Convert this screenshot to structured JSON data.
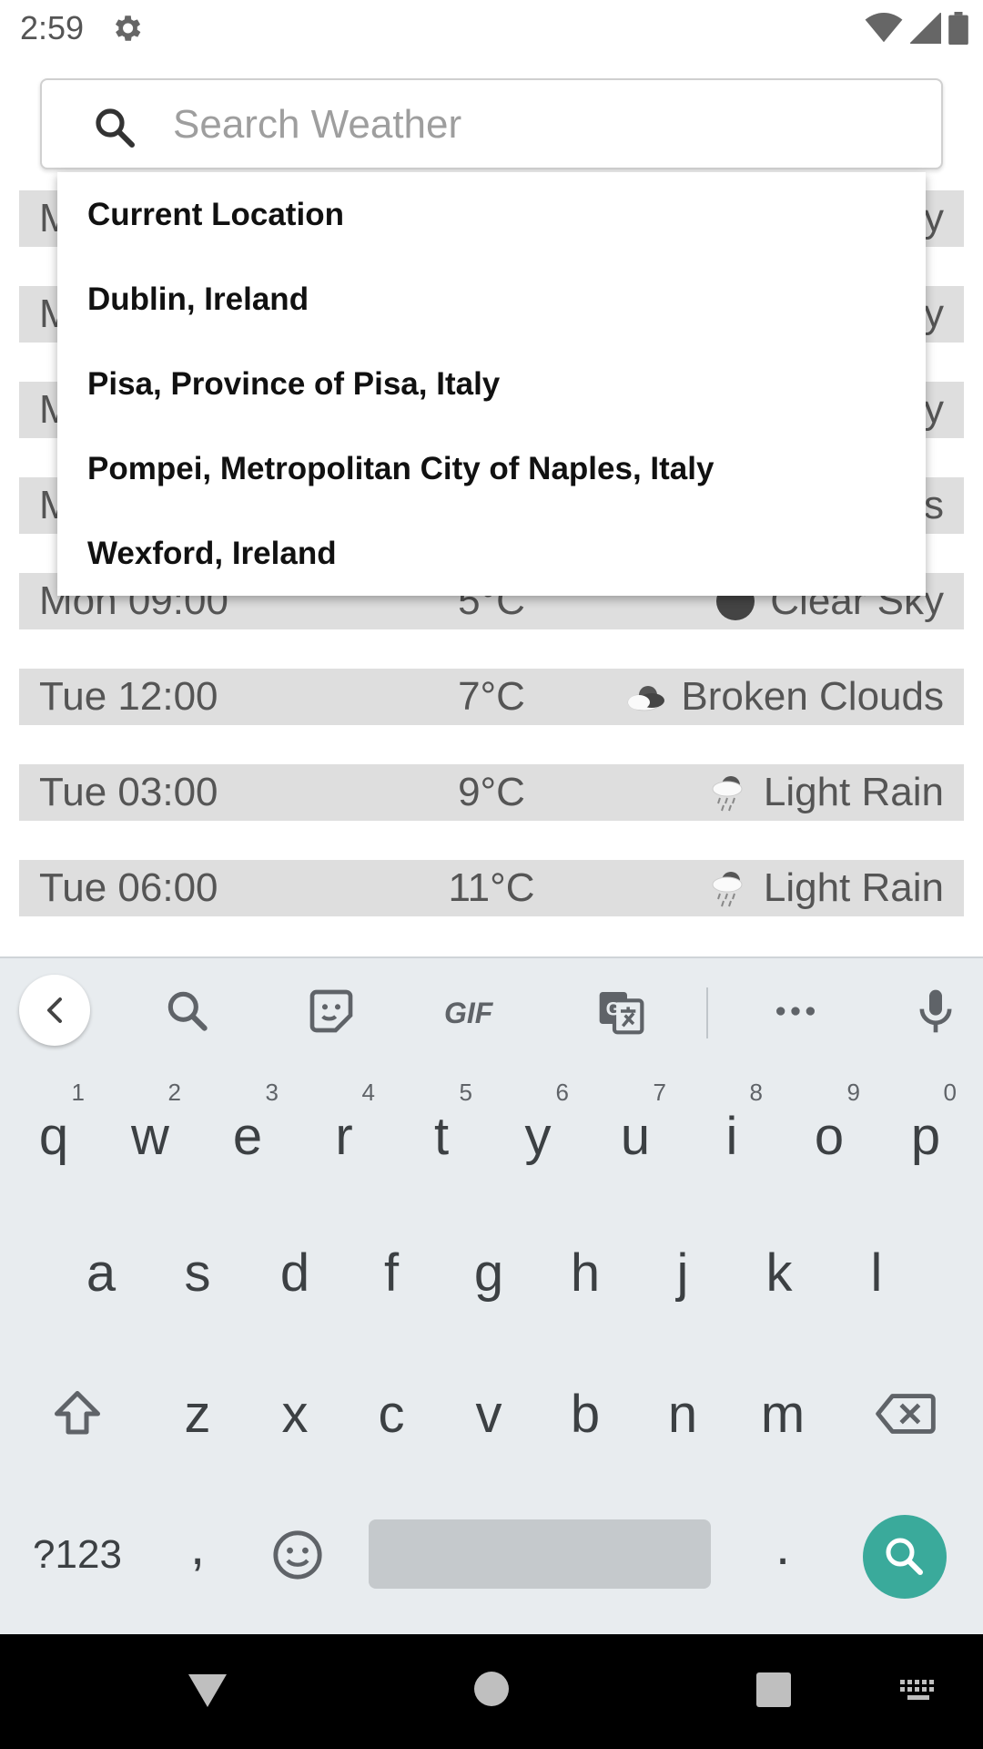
{
  "status_bar": {
    "time": "2:59",
    "icons": [
      "gear-icon",
      "wifi-icon",
      "signal-icon",
      "battery-icon"
    ]
  },
  "search": {
    "placeholder": "Search Weather",
    "value": ""
  },
  "forecast": [
    {
      "time": "Mon 09:00",
      "temp": "5°C",
      "condition": "Clear Sky",
      "icon": "clear-night-icon"
    },
    {
      "time": "Tue 12:00",
      "temp": "7°C",
      "condition": "Broken Clouds",
      "icon": "broken-clouds-icon"
    },
    {
      "time": "Tue 03:00",
      "temp": "9°C",
      "condition": "Light Rain",
      "icon": "light-rain-icon"
    },
    {
      "time": "Tue 06:00",
      "temp": "11°C",
      "condition": "Light Rain",
      "icon": "light-rain-icon"
    }
  ],
  "dropdown": {
    "items": [
      {
        "label": "Current Location"
      },
      {
        "label": "Dublin, Ireland"
      },
      {
        "label": "Pisa, Province of Pisa, Italy"
      },
      {
        "label": "Pompei, Metropolitan City of Naples, Italy"
      },
      {
        "label": "Wexford, Ireland"
      }
    ]
  },
  "keyboard": {
    "toolbar": [
      "back-icon",
      "search-icon",
      "sticker-icon",
      "GIF",
      "translate-icon",
      "more-icon",
      "microphone-icon"
    ],
    "gif_label": "GIF",
    "row1": [
      "q",
      "w",
      "e",
      "r",
      "t",
      "y",
      "u",
      "i",
      "o",
      "p"
    ],
    "row1_hints": [
      "1",
      "2",
      "3",
      "4",
      "5",
      "6",
      "7",
      "8",
      "9",
      "0"
    ],
    "row2": [
      "a",
      "s",
      "d",
      "f",
      "g",
      "h",
      "j",
      "k",
      "l"
    ],
    "row3": [
      "z",
      "x",
      "c",
      "v",
      "b",
      "n",
      "m"
    ],
    "symbols_label": "?123",
    "comma": ",",
    "period": "."
  },
  "colors": {
    "accent": "#3aaa9b",
    "row_bg": "#dedede",
    "keyboard_bg": "#e8ecef"
  }
}
